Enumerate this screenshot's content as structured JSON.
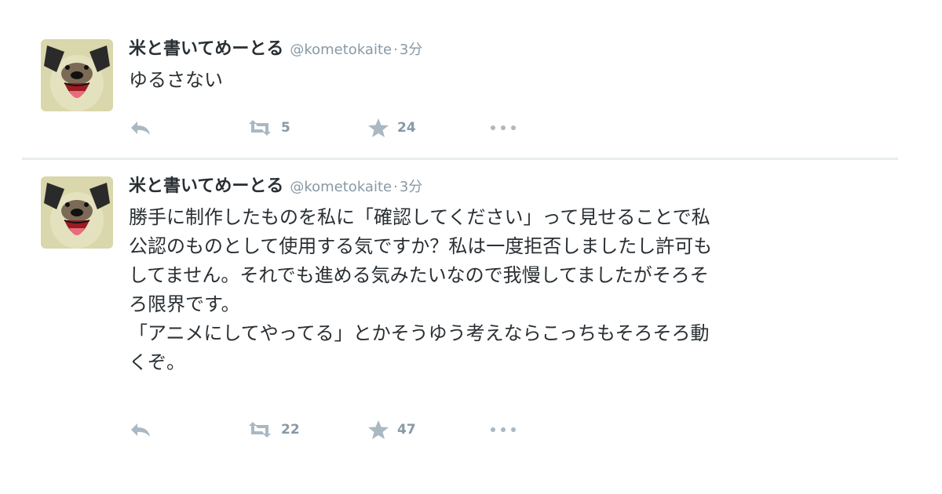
{
  "tweets": [
    {
      "display_name": "米と書いてめーとる",
      "handle": "@kometokaite",
      "separator": "·",
      "time": "3分",
      "text": "ゆるさない",
      "retweet_count": "5",
      "favorite_count": "24"
    },
    {
      "display_name": "米と書いてめーとる",
      "handle": "@kometokaite",
      "separator": "·",
      "time": "3分",
      "text": "勝手に制作したものを私に「確認してください」って見せることで私\n公認のものとして使用する気ですか？私は一度拒否しましたし許可も\nしてません。それでも進める気みたいなので我慢してましたがそろそ\nろ限界です。\n「アニメにしてやってる」とかそうゆう考えならこっちもそろそろ動\nくぞ。",
      "retweet_count": "22",
      "favorite_count": "47"
    }
  ],
  "icons": {
    "avatar": "dog-avatar",
    "reply": "reply-icon",
    "retweet": "retweet-icon",
    "favorite": "star-icon",
    "more": "more-icon"
  },
  "colors": {
    "text": "#292f33",
    "meta": "#8899a6",
    "icon": "#aab8c2",
    "divider": "#e8edf0",
    "avatar_bg": "#d9d7ab"
  }
}
